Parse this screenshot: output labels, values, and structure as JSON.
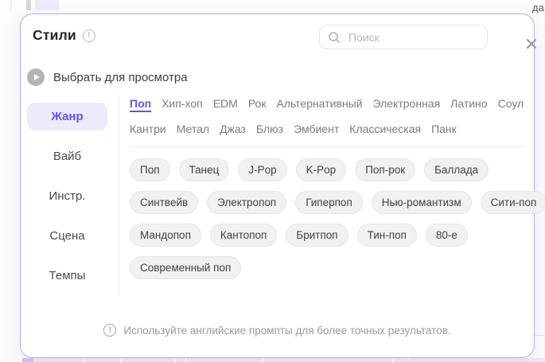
{
  "background": {
    "partial_text_top_right": "да"
  },
  "modal": {
    "title": "Стили",
    "search": {
      "placeholder": "Поиск"
    },
    "preview": {
      "label": "Выбрать для просмотра"
    },
    "sidebar": {
      "items": [
        {
          "label": "Жанр",
          "active": true
        },
        {
          "label": "Вайб",
          "active": false
        },
        {
          "label": "Инстр.",
          "active": false
        },
        {
          "label": "Сцена",
          "active": false
        },
        {
          "label": "Темпы",
          "active": false
        }
      ]
    },
    "genres": {
      "active": "Поп",
      "rows": [
        [
          "Поп",
          "Хип-хоп",
          "EDM",
          "Рок",
          "Альтернативный",
          "Электронная",
          "Латино",
          "Соул"
        ],
        [
          "Кантри",
          "Метал",
          "Джаз",
          "Блюз",
          "Эмбиент",
          "Классическая",
          "Панк"
        ]
      ]
    },
    "chips_rows": [
      [
        "Поп",
        "Танец",
        "J-Pop",
        "K-Pop",
        "Поп-рок",
        "Баллада"
      ],
      [
        "Синтвейв",
        "Электропоп",
        "Гиперпоп",
        "Нью-романтизм",
        "Сити-поп"
      ],
      [
        "Мандопоп",
        "Кантопоп",
        "Бритпоп",
        "Тин-поп",
        "80-е"
      ],
      [
        "Современный поп"
      ]
    ],
    "footer_note": "Используйте английские промпты для более точных результатов."
  },
  "colors": {
    "accent": "#6353e9",
    "accent_bg": "#edeafc",
    "modal_border": "#b7aaef",
    "chip_bg": "#f1f1f4",
    "muted_text": "#9a9a9f"
  }
}
